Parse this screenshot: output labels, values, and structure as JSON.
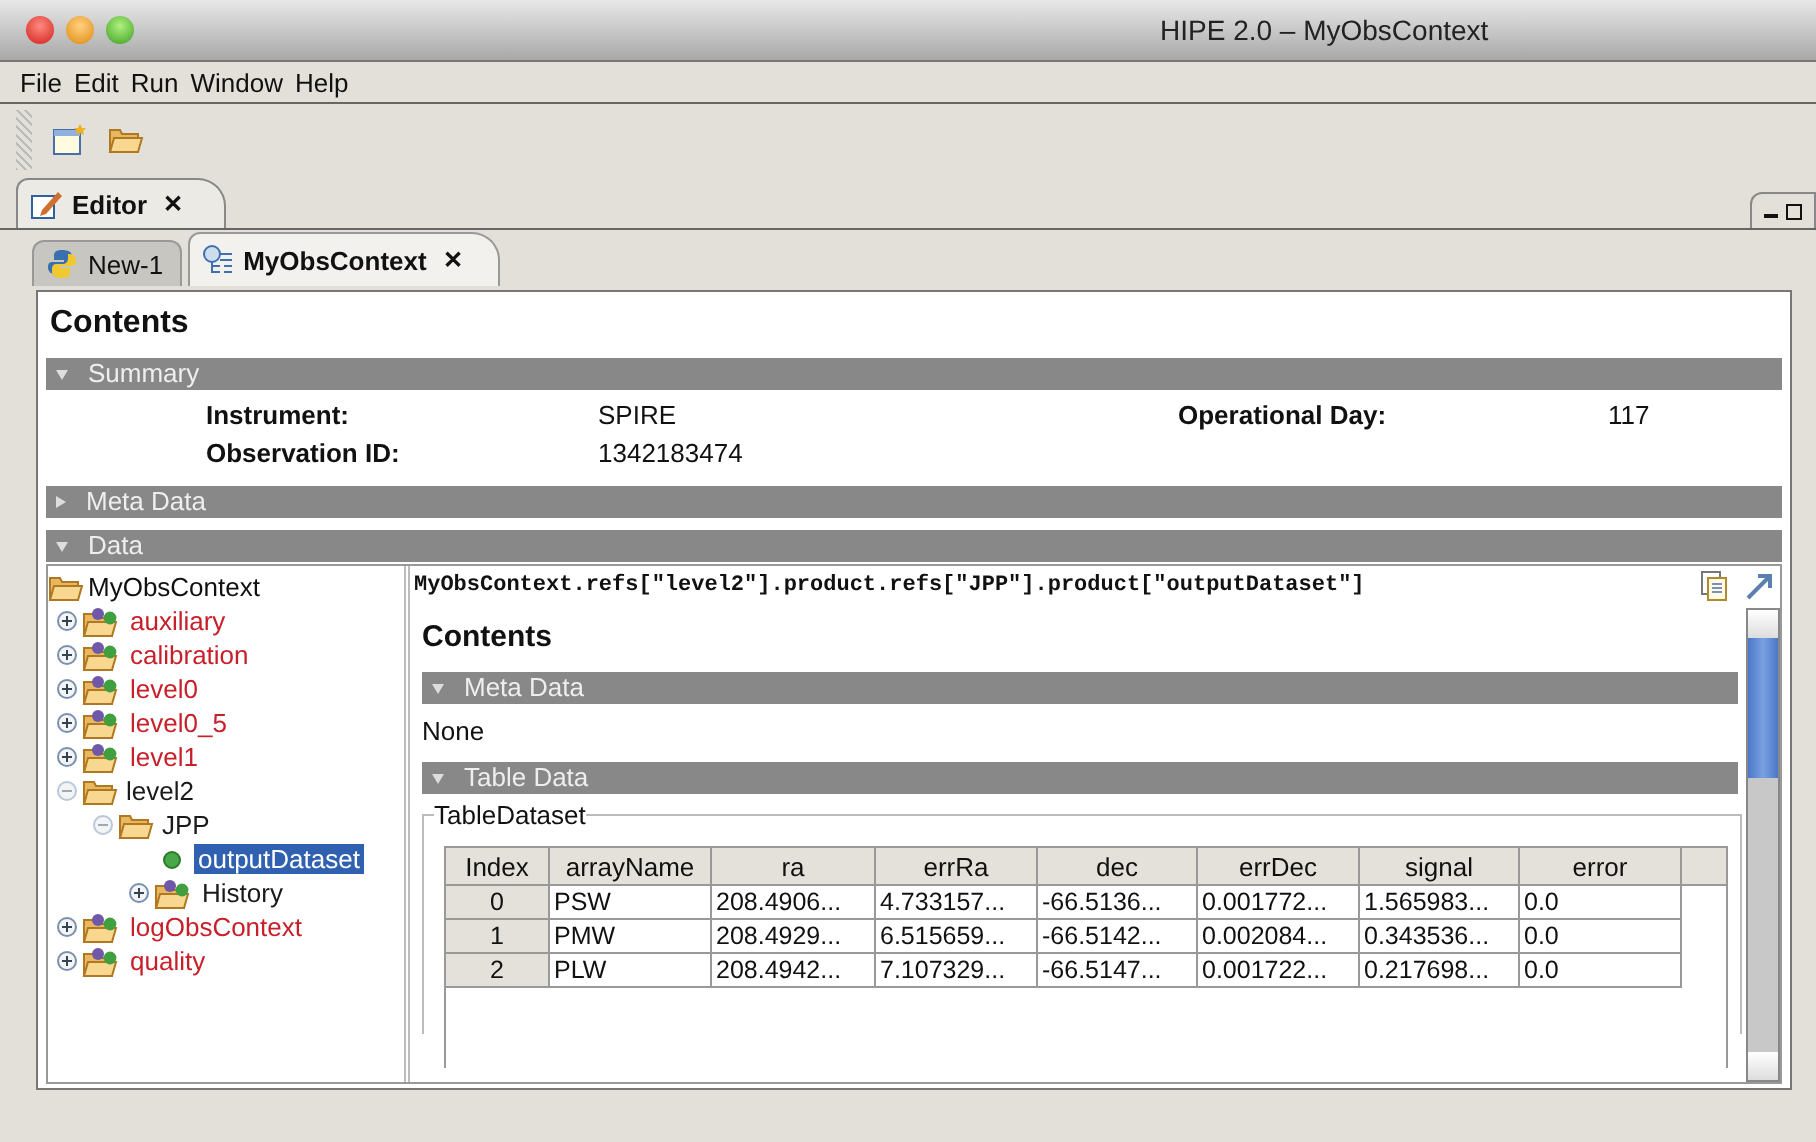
{
  "window": {
    "title": "HIPE 2.0 – MyObsContext"
  },
  "menu": [
    "File",
    "Edit",
    "Run",
    "Window",
    "Help"
  ],
  "perspective_tab": {
    "label": "Editor",
    "close": "✕"
  },
  "doc_tabs": [
    {
      "label": "New-1",
      "kind": "script",
      "selected": false
    },
    {
      "label": "MyObsContext",
      "kind": "context",
      "selected": true,
      "close": "✕"
    }
  ],
  "contents_title": "Contents",
  "sections": [
    {
      "label": "Summary",
      "expanded": true
    },
    {
      "label": "Meta Data",
      "expanded": false
    },
    {
      "label": "Data",
      "expanded": true
    }
  ],
  "summary": [
    {
      "label": "Instrument:",
      "value": "SPIRE"
    },
    {
      "label": "Operational Day:",
      "value": "117"
    },
    {
      "label": "Observation ID:",
      "value": "1342183474"
    }
  ],
  "tree": {
    "label": "MyObsContext",
    "children": [
      {
        "label": "auxiliary",
        "kind": "product",
        "color": "#c8202a",
        "expanded": false
      },
      {
        "label": "calibration",
        "kind": "product",
        "color": "#c8202a",
        "expanded": false
      },
      {
        "label": "level0",
        "kind": "product",
        "color": "#c8202a",
        "expanded": false
      },
      {
        "label": "level0_5",
        "kind": "product",
        "color": "#c8202a",
        "expanded": false
      },
      {
        "label": "level1",
        "kind": "product",
        "color": "#c8202a",
        "expanded": false
      },
      {
        "label": "level2",
        "kind": "folder",
        "color": "#1a1a1a",
        "expanded": true,
        "children": [
          {
            "label": "JPP",
            "kind": "folder",
            "color": "#1a1a1a",
            "expanded": true,
            "children": [
              {
                "label": "outputDataset",
                "kind": "dataset",
                "selected": true
              },
              {
                "label": "History",
                "kind": "product",
                "color": "#1a1a1a",
                "expanded": false,
                "selected": false
              }
            ]
          }
        ]
      },
      {
        "label": "logObsContext",
        "kind": "product",
        "color": "#c8202a",
        "expanded": false
      },
      {
        "label": "quality",
        "kind": "product",
        "color": "#c8202a",
        "expanded": false
      }
    ]
  },
  "path": "MyObsContext.refs[\"level2\"].product.refs[\"JPP\"].product[\"outputDataset\"]",
  "detail": {
    "title": "Contents",
    "sections": [
      {
        "label": "Meta Data",
        "expanded": true,
        "text": "None"
      },
      {
        "label": "Table Data",
        "expanded": true
      }
    ],
    "dataset_title": "TableDataset",
    "columns": [
      "Index",
      "arrayName",
      "ra",
      "errRa",
      "dec",
      "errDec",
      "signal",
      "error"
    ],
    "rows": [
      [
        "0",
        "PSW",
        "208.4906...",
        "4.733157...",
        "-66.5136...",
        "0.001772...",
        "1.565983...",
        "0.0"
      ],
      [
        "1",
        "PMW",
        "208.4929...",
        "6.515659...",
        "-66.5142...",
        "0.002084...",
        "0.343536...",
        "0.0"
      ],
      [
        "2",
        "PLW",
        "208.4942...",
        "7.107329...",
        "-66.5147...",
        "0.001722...",
        "0.217698...",
        "0.0"
      ]
    ]
  }
}
